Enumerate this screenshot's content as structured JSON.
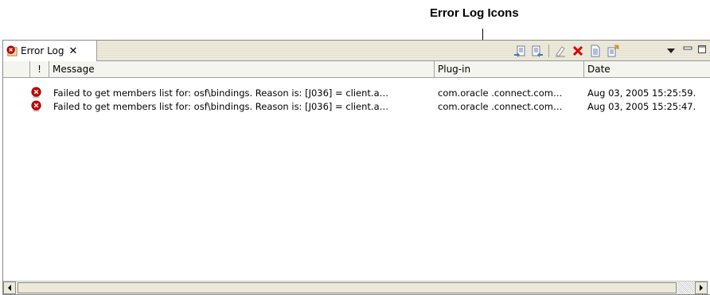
{
  "annotation": {
    "label": "Error Log Icons"
  },
  "view": {
    "tab_title": "Error Log",
    "tab_close": "✕",
    "toolbar_icons": [
      "export-log-icon",
      "import-log-icon",
      "clear-log-viewer-icon",
      "delete-log-icon",
      "open-log-icon",
      "restore-log-icon"
    ],
    "menu_icons": [
      "view-menu-icon",
      "minimize-icon",
      "maximize-icon"
    ]
  },
  "table": {
    "columns": [
      "!",
      "Message",
      "Plug-in",
      "Date"
    ],
    "rows": [
      {
        "severity_icon": "error-icon",
        "message": "Failed to get members list for:  osf\\bindings. Reason is:  [J036] = client.a…",
        "plugin": "com.oracle .connect.com…",
        "date": "Aug 03, 2005 15:25:59."
      },
      {
        "severity_icon": "error-icon",
        "message": "Failed to get members list for:  osf\\bindings. Reason is:  [J036] = client.a…",
        "plugin": "com.oracle .connect.com…",
        "date": "Aug 03, 2005 15:25:47."
      }
    ]
  },
  "colors": {
    "error": "#d40000",
    "tabbar": "#ece9d8"
  }
}
